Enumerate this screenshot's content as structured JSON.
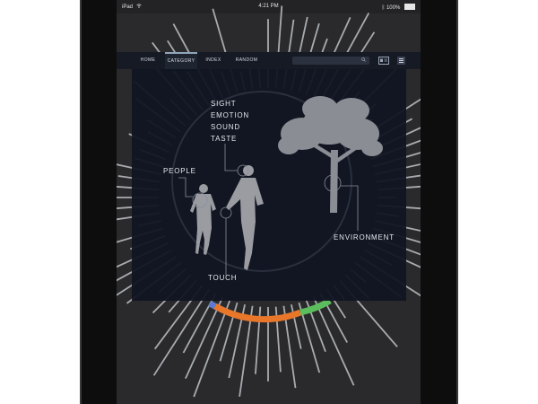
{
  "status_bar": {
    "device": "iPad",
    "time": "4:21 PM",
    "battery": "100%"
  },
  "nav": {
    "tabs": [
      {
        "label": "HOME",
        "active": false
      },
      {
        "label": "CATEGORY",
        "active": true
      },
      {
        "label": "INDEX",
        "active": false
      },
      {
        "label": "RANDOM",
        "active": false
      }
    ],
    "search_placeholder": ""
  },
  "overlay": {
    "senses": [
      "SIGHT",
      "EMOTION",
      "SOUND",
      "TASTE"
    ],
    "people_label": "PEOPLE",
    "touch_label": "TOUCH",
    "environment_label": "ENVIRONMENT"
  },
  "colors": {
    "accent_orange": "#e8772a",
    "accent_green": "#5bbd5b",
    "accent_blue": "#5a7bd1",
    "panel": "#101522",
    "nav_bg": "#161a24"
  },
  "icons": [
    "wifi-icon",
    "bluetooth-icon",
    "battery-icon",
    "search-icon",
    "id-card-icon",
    "menu-icon"
  ]
}
